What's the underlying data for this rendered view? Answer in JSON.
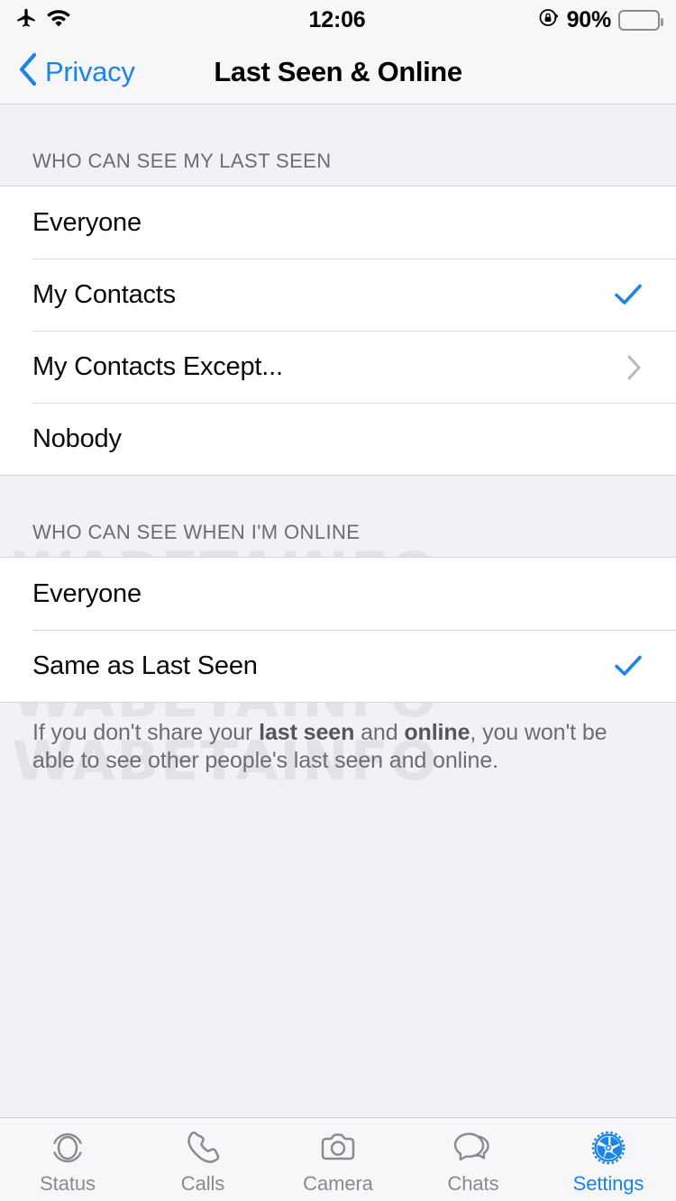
{
  "status_bar": {
    "airplane_icon": "airplane-mode-icon",
    "wifi_icon": "wifi-icon",
    "time": "12:06",
    "rotation_lock_icon": "rotation-lock-icon",
    "battery_percent": "90%",
    "battery_level": 90,
    "battery_color": "#FCCF2C"
  },
  "nav": {
    "back_label": "Privacy",
    "title": "Last Seen & Online",
    "accent_color": "#1B84E7"
  },
  "watermark": {
    "text": "WABETAINFO"
  },
  "sections": [
    {
      "header": "WHO CAN SEE MY LAST SEEN",
      "rows": [
        {
          "label": "Everyone",
          "accessory": "none"
        },
        {
          "label": "My Contacts",
          "accessory": "check"
        },
        {
          "label": "My Contacts Except...",
          "accessory": "chevron"
        },
        {
          "label": "Nobody",
          "accessory": "none"
        }
      ]
    },
    {
      "header": "WHO CAN SEE WHEN I'M ONLINE",
      "rows": [
        {
          "label": "Everyone",
          "accessory": "none"
        },
        {
          "label": "Same as Last Seen",
          "accessory": "check"
        }
      ]
    }
  ],
  "footer_note": {
    "part1": "If you don't share your ",
    "bold1": "last seen",
    "part2": " and ",
    "bold2": "online",
    "part3": ", you won't be able to see other people's last seen and online."
  },
  "tab_bar": {
    "items": [
      {
        "label": "Status",
        "icon": "status-rings-icon",
        "active": false
      },
      {
        "label": "Calls",
        "icon": "phone-handset-icon",
        "active": false
      },
      {
        "label": "Camera",
        "icon": "camera-icon",
        "active": false
      },
      {
        "label": "Chats",
        "icon": "chat-bubbles-icon",
        "active": false
      },
      {
        "label": "Settings",
        "icon": "gear-icon",
        "active": true
      }
    ],
    "active_color": "#1B84E7",
    "inactive_color": "#8A8A8F"
  }
}
